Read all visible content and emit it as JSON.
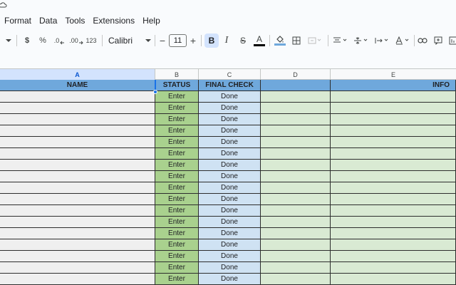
{
  "menu": [
    "Format",
    "Data",
    "Tools",
    "Extensions",
    "Help"
  ],
  "toolbar": {
    "currency": "$",
    "percent": "%",
    "decimal_decrease": ".0",
    "decimal_increase": ".00",
    "number_format": "123",
    "font": "Calibri",
    "font_size": "11",
    "minus": "−",
    "plus": "+",
    "bold": "B",
    "italic": "I",
    "strike": "S",
    "text_color_letter": "A",
    "text_color": "#000000",
    "highlight_color": "#6fa8dc"
  },
  "columns": [
    "A",
    "B",
    "C",
    "D",
    "E"
  ],
  "selected_column": "A",
  "sheet": {
    "headers": [
      "NAME",
      "STATUS",
      "FINAL CHECK",
      "",
      "INFO"
    ],
    "status_value": "Enter",
    "check_value": "Done",
    "rows": [
      [
        "",
        "Enter",
        "Done",
        "",
        ""
      ],
      [
        "",
        "Enter",
        "Done",
        "",
        ""
      ],
      [
        "",
        "Enter",
        "Done",
        "",
        ""
      ],
      [
        "",
        "Enter",
        "Done",
        "",
        ""
      ],
      [
        "",
        "Enter",
        "Done",
        "",
        ""
      ],
      [
        "",
        "Enter",
        "Done",
        "",
        ""
      ],
      [
        "",
        "Enter",
        "Done",
        "",
        ""
      ],
      [
        "",
        "Enter",
        "Done",
        "",
        ""
      ],
      [
        "",
        "Enter",
        "Done",
        "",
        ""
      ],
      [
        "",
        "Enter",
        "Done",
        "",
        ""
      ],
      [
        "",
        "Enter",
        "Done",
        "",
        ""
      ],
      [
        "",
        "Enter",
        "Done",
        "",
        ""
      ],
      [
        "",
        "Enter",
        "Done",
        "",
        ""
      ],
      [
        "",
        "Enter",
        "Done",
        "",
        ""
      ],
      [
        "",
        "Enter",
        "Done",
        "",
        ""
      ],
      [
        "",
        "Enter",
        "Done",
        "",
        ""
      ],
      [
        "",
        "Enter",
        "Done",
        "",
        ""
      ]
    ]
  },
  "colors": {
    "header_blue": "#6fa8dc",
    "status_green": "#a9d18e",
    "check_blue": "#cfe2f3",
    "info_green": "#d9ead3",
    "name_gray": "#efefef"
  }
}
